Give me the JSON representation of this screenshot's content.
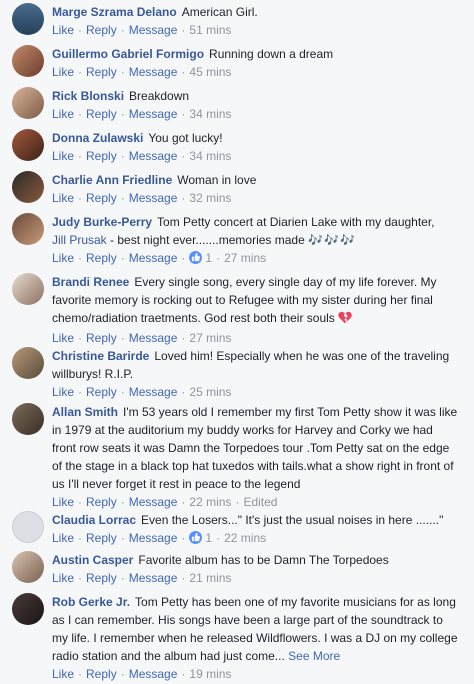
{
  "actions": {
    "like": "Like",
    "reply": "Reply",
    "message": "Message",
    "edited": "Edited",
    "see_more": "See More"
  },
  "comments": [
    {
      "author": "Marge Szrama Delano",
      "text": "American Girl.",
      "time": "51 mins"
    },
    {
      "author": "Guillermo Gabriel Formigo",
      "text": "Running down a dream",
      "time": "45 mins"
    },
    {
      "author": "Rick Blonski",
      "text": "Breakdown",
      "time": "34 mins"
    },
    {
      "author": "Donna Zulawski",
      "text": "You got lucky!",
      "time": "34 mins"
    },
    {
      "author": "Charlie Ann Friedline",
      "text": "Woman in love",
      "time": "32 mins"
    },
    {
      "author": "Judy Burke-Perry",
      "text": "Tom Petty concert at Diarien Lake with my daughter,",
      "mention": "Jill Prusak",
      "text2": "- best night ever.......memories made",
      "emoji": "🎶🎶🎶",
      "reactions": "1",
      "time": "27 mins"
    },
    {
      "author": "Brandi Renee",
      "text": "Every single song, every single day of my life forever. My favorite memory is rocking out to Refugee with my sister during her final chemo/radiation traetments. God rest both their souls",
      "time": "27 mins"
    },
    {
      "author": "Christine Barirde",
      "text": "Loved him! Especially when he was one of the traveling willburys! R.I.P.",
      "time": "25 mins"
    },
    {
      "author": "Allan Smith",
      "text": "I'm 53 years old I remember my first Tom Petty show it was like in 1979 at the auditorium my buddy works for Harvey and Corky we had front row seats it was Damn the Torpedoes tour .Tom Petty sat on the edge of the stage in a black top hat tuxedos with tails.what a show right in front of us I'll never forget it rest in peace to the legend",
      "time": "22 mins"
    },
    {
      "author": "Claudia Lorrac",
      "text": "Even the Losers...\" It's just the usual noises in here .......\"",
      "reactions": "1",
      "time": "22 mins"
    },
    {
      "author": "Austin Casper",
      "text": "Favorite album has to be Damn The Torpedoes",
      "time": "21 mins"
    },
    {
      "author": "Rob Gerke Jr.",
      "text": "Tom Petty has been one of my favorite musicians for as long as I can remember. His songs have been a large part of the soundtrack to my life. I remember when he released Wildflowers. I was a DJ on my college radio station and the album had just come...",
      "time": "19 mins"
    }
  ]
}
